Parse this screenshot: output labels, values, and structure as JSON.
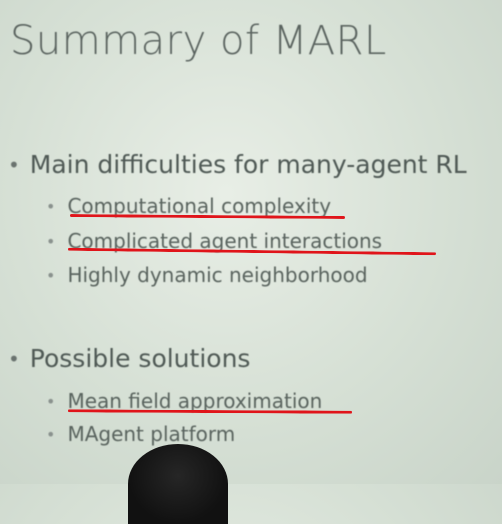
{
  "slide": {
    "title": "Summary of MARL",
    "sections": [
      {
        "heading": "Main difficulties for many-agent RL",
        "items": [
          "Computational complexity",
          "Complicated agent interactions",
          "Highly dynamic neighborhood"
        ]
      },
      {
        "heading": "Possible solutions",
        "items": [
          "Mean field approximation",
          "MAgent platform"
        ]
      }
    ],
    "bullet_glyph": "•"
  },
  "colors": {
    "background": "#d6e0d5",
    "text": "#555f5a",
    "annotation_underline": "#e0141a"
  }
}
